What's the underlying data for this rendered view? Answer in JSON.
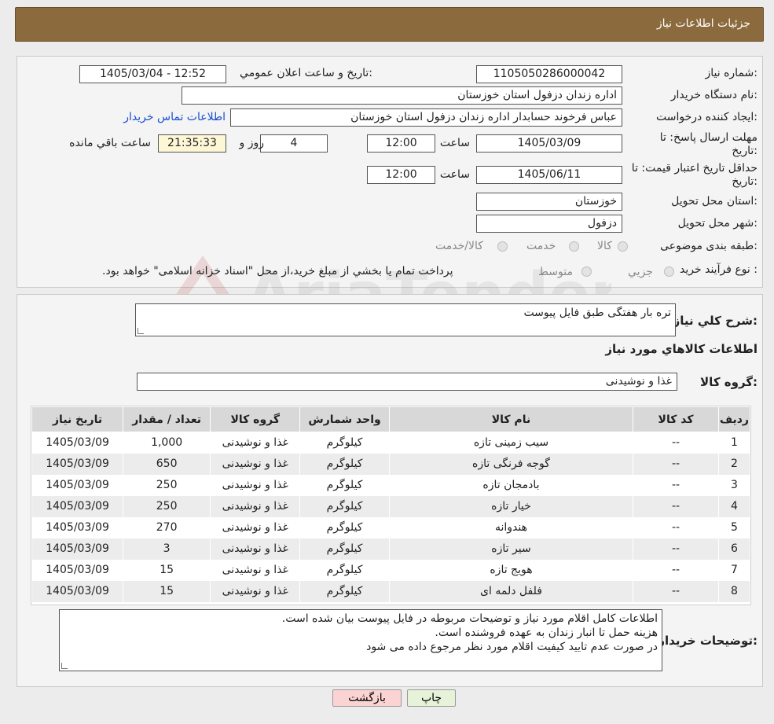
{
  "header": {
    "title": "جزئیات اطلاعات نیاز"
  },
  "form": {
    "need_number_label": "شماره نیاز:",
    "need_number": "1105050286000042",
    "announce_label": "تاریخ و ساعت اعلان عمومي:",
    "announce_value": "1405/03/04 - 12:52",
    "buyer_org_label": "نام دستگاه خريدار:",
    "buyer_org": "اداره زندان دزفول استان خوزستان",
    "creator_label": "ايجاد کننده درخواست:",
    "creator": "عباس فرخوند حسابدار اداره زندان دزفول استان خوزستان",
    "contact_link": "اطلاعات تماس خريدار",
    "deadline_label_1": "مهلت ارسال پاسخ: تا",
    "deadline_label_2": "تاریخ:",
    "deadline_date": "1405/03/09",
    "time_label": "ساعت",
    "deadline_time": "12:00",
    "days_value": "4",
    "days_label": "روز و",
    "remaining_time": "21:35:33",
    "remaining_label": "ساعت باقي مانده",
    "validity_label_1": "حداقل تاريخ اعتبار قيمت: تا",
    "validity_label_2": "تاريخ:",
    "validity_date": "1405/06/11",
    "validity_time": "12:00",
    "province_label": "استان محل تحويل:",
    "province": "خوزستان",
    "city_label": "شهر محل تحويل:",
    "city": "دزفول",
    "category_label": "طبقه بندی موضوعی:",
    "category_options": [
      "کالا",
      "خدمت",
      "کالا/خدمت"
    ],
    "process_label": "نوع فرآيند خريد :",
    "process_options": [
      "جزيي",
      "متوسط"
    ],
    "process_note": "پرداخت تمام يا بخشي از مبلغ خريد،از محل \"اسناد خزانه اسلامی\" خواهد بود."
  },
  "summary": {
    "label": "شرح كلي نياز:",
    "value": "تره بار هفتگی طبق فایل پیوست",
    "items_heading": "اطلاعات كالاهاي مورد نياز",
    "group_label": "گروه کالا:",
    "group_value": "غذا و نوشیدنی"
  },
  "table": {
    "headers": [
      "رديف",
      "كد كالا",
      "نام كالا",
      "واحد شمارش",
      "گروه كالا",
      "تعداد / مقدار",
      "تاريخ نياز"
    ],
    "rows": [
      [
        "1",
        "--",
        "سیب زمینی تازه",
        "کیلوگرم",
        "غذا و نوشیدنی",
        "1,000",
        "1405/03/09"
      ],
      [
        "2",
        "--",
        "گوجه فرنگی تازه",
        "کیلوگرم",
        "غذا و نوشیدنی",
        "650",
        "1405/03/09"
      ],
      [
        "3",
        "--",
        "بادمجان تازه",
        "کیلوگرم",
        "غذا و نوشیدنی",
        "250",
        "1405/03/09"
      ],
      [
        "4",
        "--",
        "خیار تازه",
        "کیلوگرم",
        "غذا و نوشیدنی",
        "250",
        "1405/03/09"
      ],
      [
        "5",
        "--",
        "هندوانه",
        "کیلوگرم",
        "غذا و نوشیدنی",
        "270",
        "1405/03/09"
      ],
      [
        "6",
        "--",
        "سیر تازه",
        "کیلوگرم",
        "غذا و نوشیدنی",
        "3",
        "1405/03/09"
      ],
      [
        "7",
        "--",
        "هویج تازه",
        "کیلوگرم",
        "غذا و نوشیدنی",
        "15",
        "1405/03/09"
      ],
      [
        "8",
        "--",
        "فلفل دلمه ای",
        "کیلوگرم",
        "غذا و نوشیدنی",
        "15",
        "1405/03/09"
      ]
    ]
  },
  "notes": {
    "label": "توضيحات خريدار:",
    "lines": [
      "اطلاعات کامل اقلام مورد نیاز و توضیحات مربوطه در فایل پیوست بیان شده است.",
      "هزینه حمل تا انبار زندان به عهده فروشنده است.",
      "در صورت عدم تایید کیفیت اقلام مورد نظر مرجوع داده می شود"
    ]
  },
  "buttons": {
    "print": "چاپ",
    "back": "بازگشت"
  },
  "watermark": {
    "text": "AriaTender.neT"
  },
  "colors": {
    "header_bg": "#8b6a3e",
    "link": "#1a4fd1",
    "back_button_bg": "#fbd3d3",
    "print_button_bg": "#e6f3d9"
  }
}
